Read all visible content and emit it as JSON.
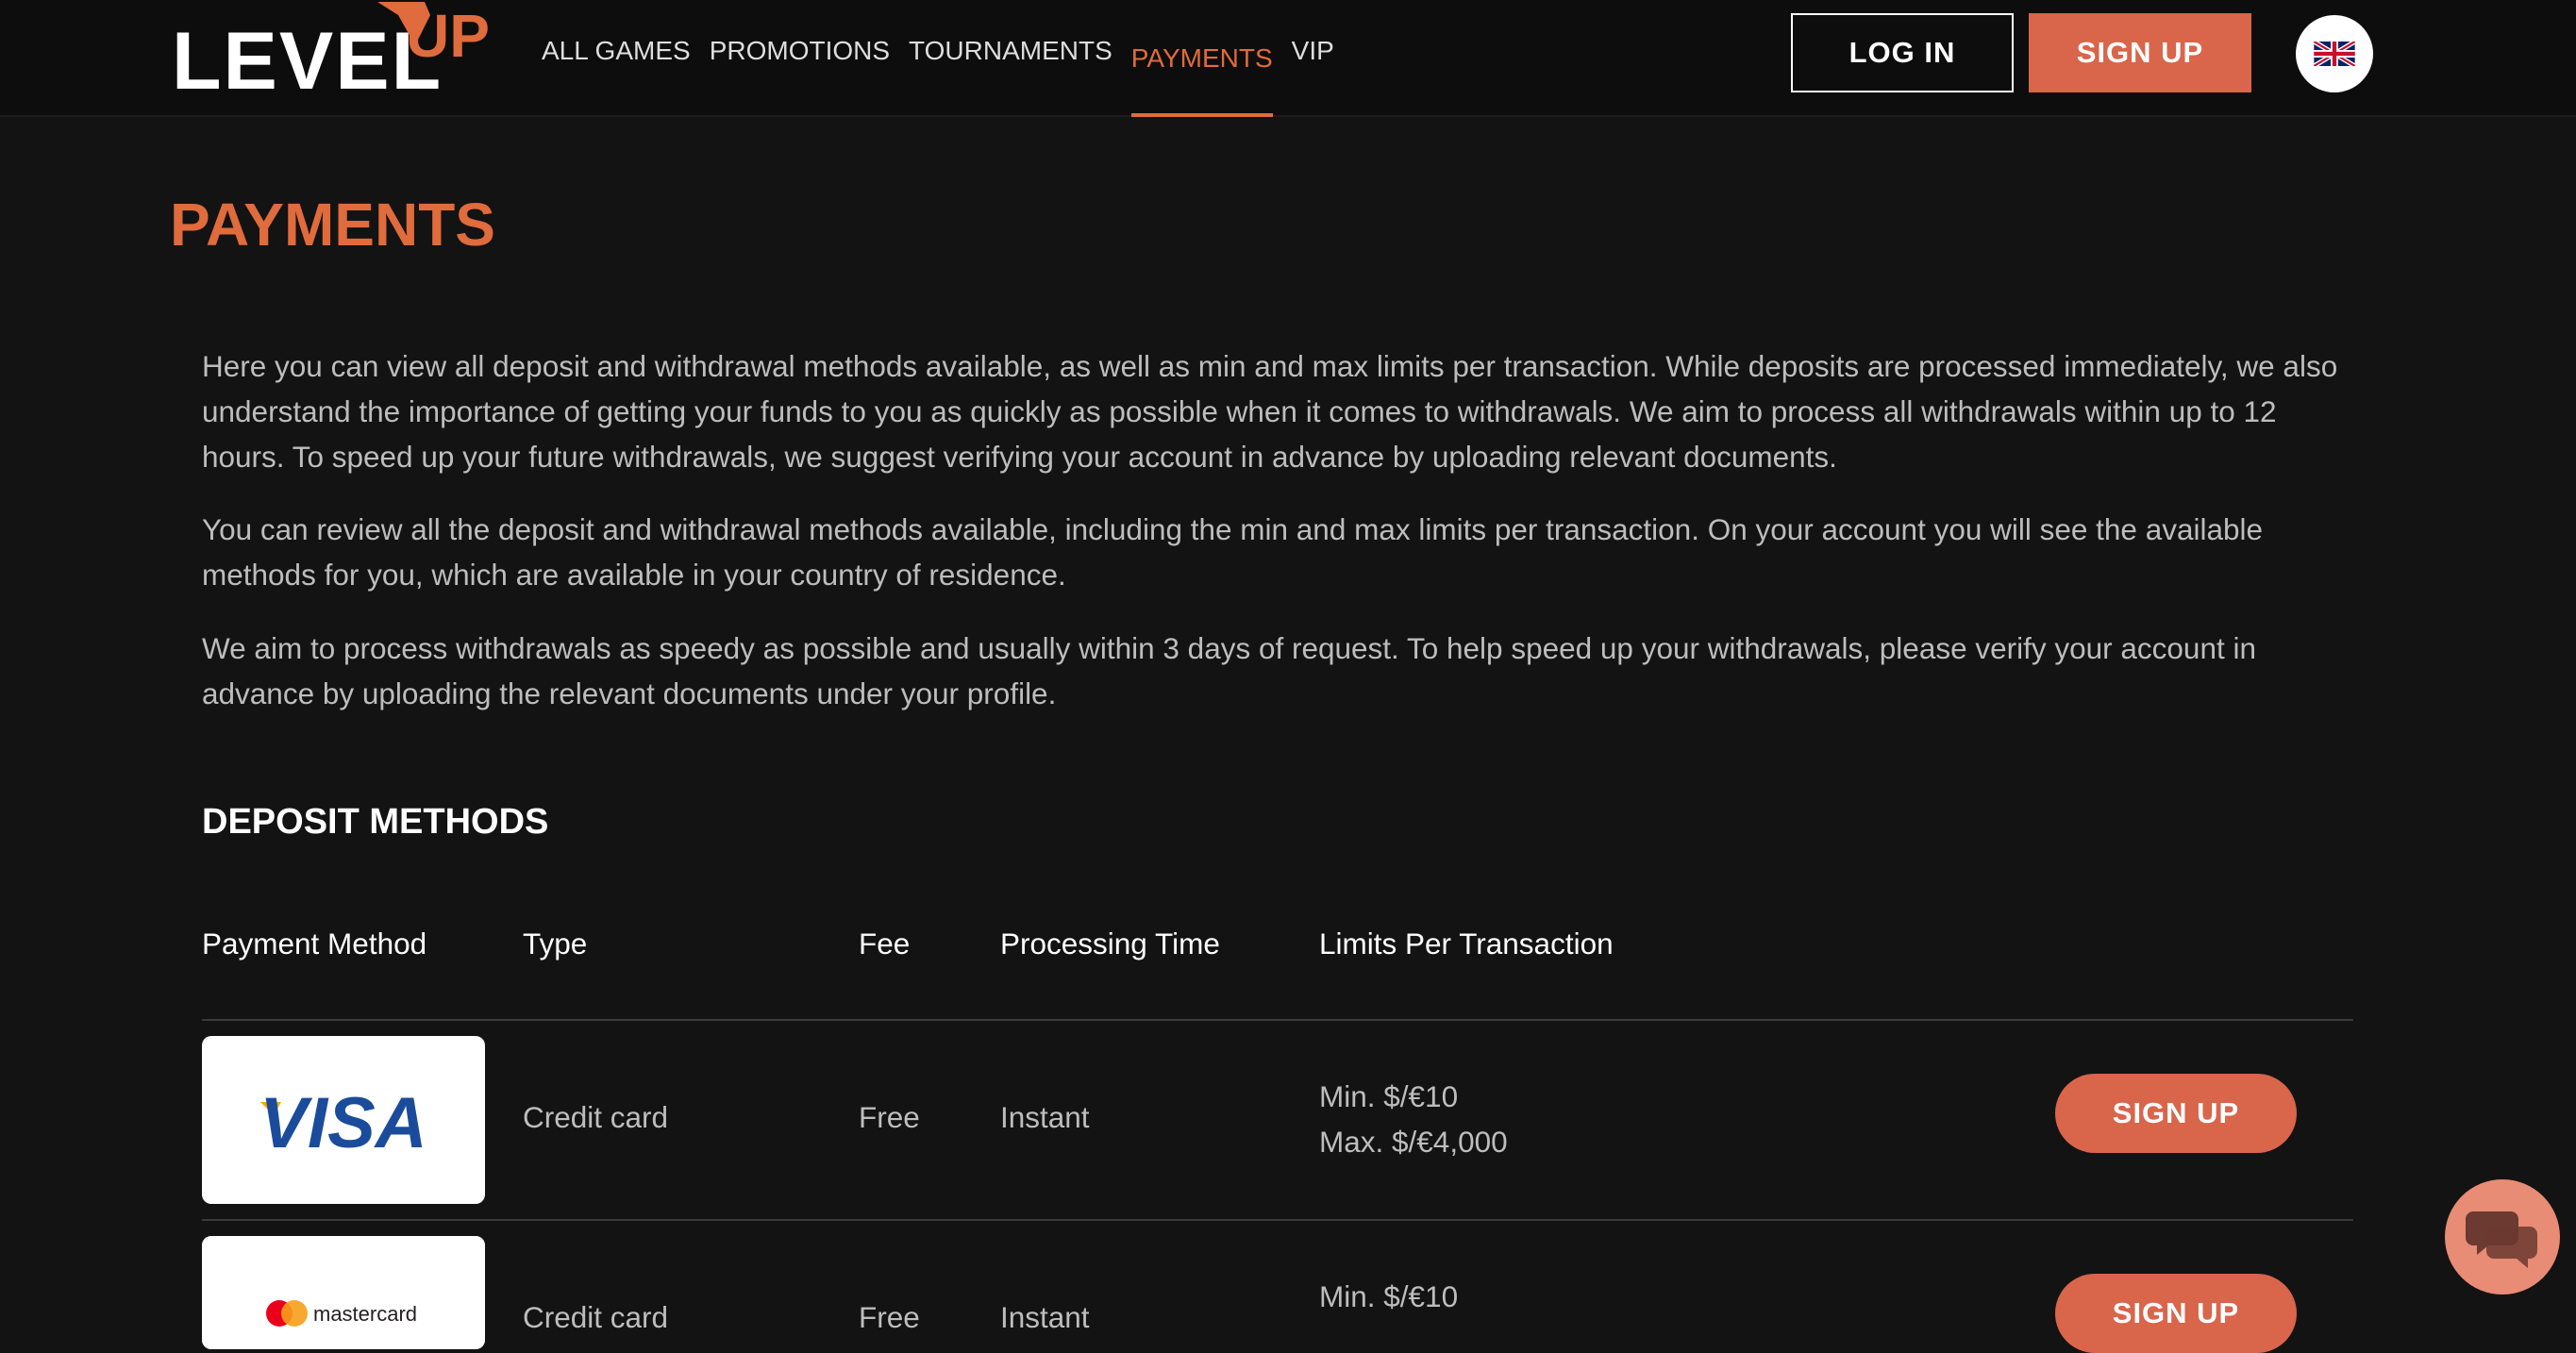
{
  "header": {
    "logo_level": "LEVEL",
    "logo_up": "UP",
    "nav": [
      "ALL GAMES",
      "PROMOTIONS",
      "TOURNAMENTS",
      "PAYMENTS",
      "VIP"
    ],
    "active_nav": "PAYMENTS",
    "login_label": "LOG IN",
    "signup_label": "SIGN UP",
    "language_icon": "uk-flag-icon"
  },
  "page": {
    "title": "PAYMENTS",
    "paragraphs": [
      "Here you can view all deposit and withdrawal methods available, as well as min and max limits per transaction. While deposits are processed immediately, we also understand the importance of getting your funds to you as quickly as possible when it comes to withdrawals. We aim to process all withdrawals within up to 12 hours. To speed up your future withdrawals, we suggest verifying your account in advance by uploading relevant documents.",
      "You can review all the deposit and withdrawal methods available, including the min and max limits per transaction. On your account you will see the available methods for you, which are available in your country of residence.",
      "We aim to process withdrawals as speedy as possible and usually within 3 days of request. To help speed up your withdrawals, please verify your account in advance by uploading the relevant documents under your profile."
    ]
  },
  "deposit": {
    "section_title": "DEPOSIT METHODS",
    "columns": [
      "Payment Method",
      "Type",
      "Fee",
      "Processing Time",
      "Limits Per Transaction"
    ],
    "rows": [
      {
        "logo": "VISA",
        "logo_icon": "visa-logo",
        "type": "Credit card",
        "fee": "Free",
        "time": "Instant",
        "min": "Min. $/€10",
        "max": "Max. $/€4,000",
        "button": "SIGN UP"
      },
      {
        "logo": "mastercard",
        "logo_icon": "mastercard-logo",
        "type": "Credit card",
        "fee": "Free",
        "time": "Instant",
        "min": "Min. $/€10",
        "max": "",
        "button": "SIGN UP"
      }
    ]
  },
  "chat": {
    "icon": "chat-bubbles-icon"
  },
  "colors": {
    "accent": "#e06b3c",
    "button": "#d9654a",
    "background": "#131313",
    "header": "#0d0d0d",
    "body_text": "#bdbdbd",
    "chat_button": "#e88c75"
  }
}
